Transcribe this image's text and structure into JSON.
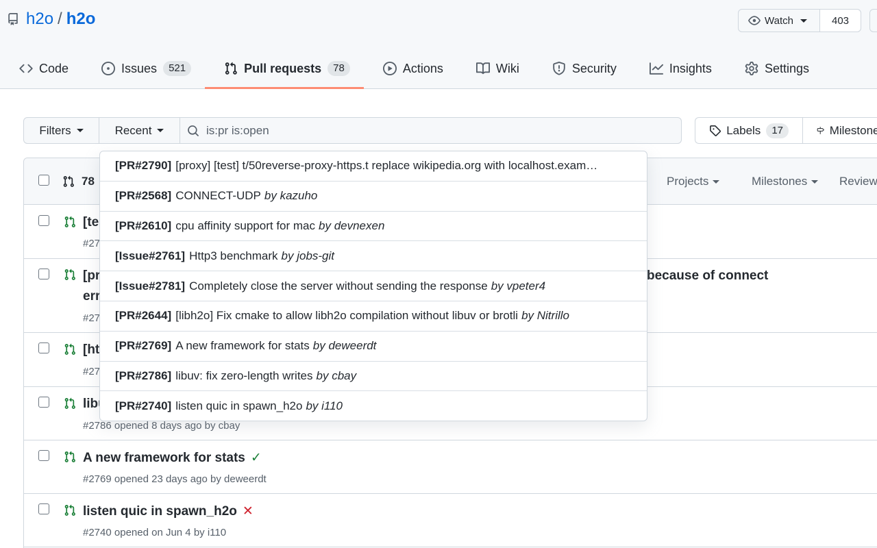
{
  "repo": {
    "owner": "h2o",
    "separator": "/",
    "name": "h2o"
  },
  "watch": {
    "label": "Watch",
    "count": "403"
  },
  "tabs": [
    {
      "label": "Code",
      "icon": "code-icon"
    },
    {
      "label": "Issues",
      "count": "521",
      "icon": "issue-icon"
    },
    {
      "label": "Pull requests",
      "count": "78",
      "icon": "pull-request-icon"
    },
    {
      "label": "Actions",
      "icon": "play-icon"
    },
    {
      "label": "Wiki",
      "icon": "book-icon"
    },
    {
      "label": "Security",
      "icon": "shield-icon"
    },
    {
      "label": "Insights",
      "icon": "graph-icon"
    },
    {
      "label": "Settings",
      "icon": "gear-icon"
    }
  ],
  "filters": {
    "filters_label": "Filters",
    "recent_label": "Recent",
    "search_value": "is:pr is:open"
  },
  "labels": {
    "label": "Labels",
    "count": "17",
    "milestones_label": "Milestones"
  },
  "list_header": {
    "count": "78",
    "projects": "Projects",
    "milestones": "Milestones",
    "reviews": "Reviews"
  },
  "rows": [
    {
      "title": "[te",
      "meta": "#27",
      "status": ""
    },
    {
      "title": "[pr",
      "title_right": "because of connect",
      "title_line2": "err",
      "meta": "#27",
      "status": ""
    },
    {
      "title": "[ht",
      "meta": "#27",
      "status": ""
    },
    {
      "title": "libu",
      "meta": "#2786 opened 8 days ago by cbay",
      "status": ""
    },
    {
      "title": "A new framework for stats",
      "meta": "#2769 opened 23 days ago by deweerdt",
      "status": "✓"
    },
    {
      "title": "listen quic in spawn_h2o",
      "meta": "#2740 opened on Jun 4 by i110",
      "status": "✕"
    }
  ],
  "dropdown": [
    {
      "ref": "[PR#2790]",
      "text": "[proxy] [test] t/50reverse-proxy-https.t replace wikipedia.org with localhost.exam…",
      "by": ""
    },
    {
      "ref": "[PR#2568]",
      "text": "CONNECT-UDP",
      "by": "by kazuho"
    },
    {
      "ref": "[PR#2610]",
      "text": "cpu affinity support for mac",
      "by": "by devnexen"
    },
    {
      "ref": "[Issue#2761]",
      "text": "Http3 benchmark",
      "by": "by jobs-git"
    },
    {
      "ref": "[Issue#2781]",
      "text": "Completely close the server without sending the response",
      "by": "by vpeter4"
    },
    {
      "ref": "[PR#2644]",
      "text": "[libh2o] Fix cmake to allow libh2o compilation without libuv or brotli",
      "by": "by Nitrillo"
    },
    {
      "ref": "[PR#2769]",
      "text": "A new framework for stats",
      "by": "by deweerdt"
    },
    {
      "ref": "[PR#2786]",
      "text": "libuv: fix zero-length writes",
      "by": "by cbay"
    },
    {
      "ref": "[PR#2740]",
      "text": "listen quic in spawn_h2o",
      "by": "by i110"
    }
  ]
}
